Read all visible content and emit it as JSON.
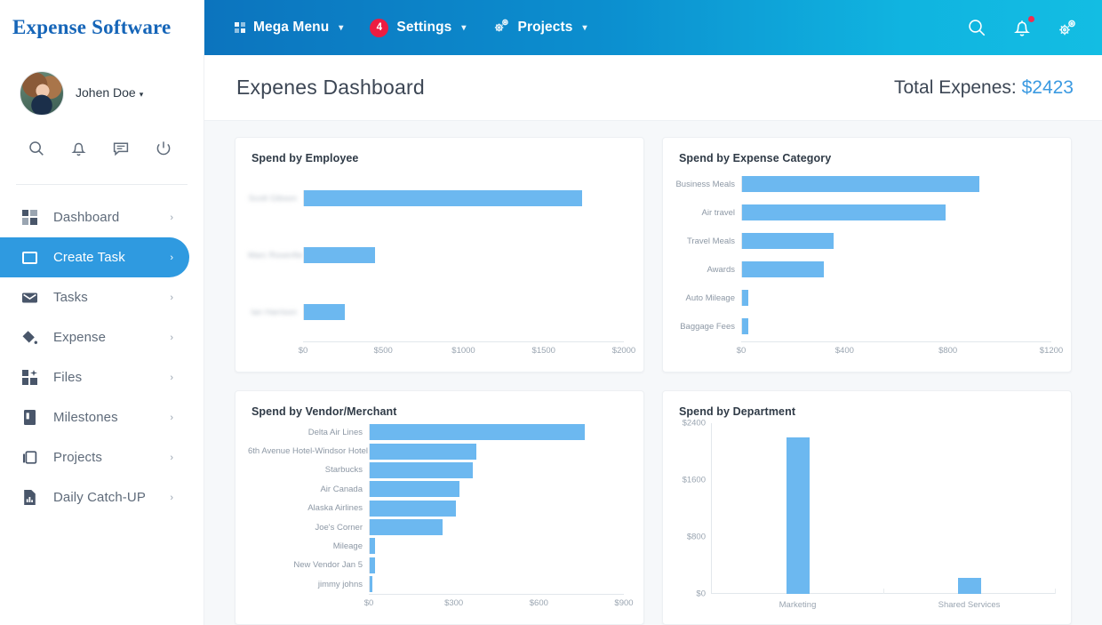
{
  "brand": {
    "title": "Expense Software"
  },
  "navbar": {
    "items": [
      {
        "label": "Mega Menu",
        "icon": "grid-icon",
        "caret": "▾",
        "badge": null
      },
      {
        "label": "Settings",
        "icon": "badge-count",
        "caret": "▾",
        "badge": "4"
      },
      {
        "label": "Projects",
        "icon": "gears-icon",
        "caret": "▾",
        "badge": null
      }
    ],
    "right_icons": [
      {
        "name": "search-icon",
        "alert": false
      },
      {
        "name": "bell-icon",
        "alert": true
      },
      {
        "name": "gears-icon",
        "alert": false
      }
    ],
    "badge_color": "#ec1c41",
    "gradient_from": "#0c74be",
    "gradient_to": "#13bde3"
  },
  "sidebar": {
    "profile": {
      "name": "Johen Doe",
      "caret": "▾",
      "avatar": "user-avatar"
    },
    "quick_icons": [
      {
        "name": "search-icon"
      },
      {
        "name": "bell-icon"
      },
      {
        "name": "chat-icon"
      },
      {
        "name": "power-icon"
      }
    ],
    "chevron": "›",
    "items": [
      {
        "label": "Dashboard",
        "icon": "dashboard-grid-icon",
        "active": false
      },
      {
        "label": "Create Task",
        "icon": "square-icon",
        "active": true
      },
      {
        "label": "Tasks",
        "icon": "envelope-icon",
        "active": false
      },
      {
        "label": "Expense",
        "icon": "paint-bucket-icon",
        "active": false
      },
      {
        "label": "Files",
        "icon": "files-icon",
        "active": false
      },
      {
        "label": "Milestones",
        "icon": "book-icon",
        "active": false
      },
      {
        "label": "Projects",
        "icon": "copy-layers-icon",
        "active": false
      },
      {
        "label": "Daily Catch-UP",
        "icon": "report-chart-icon",
        "active": false
      }
    ],
    "active_color": "#2f9ae0"
  },
  "page": {
    "title": "Expenes Dashboard",
    "total_label": "Total Expenes: ",
    "total_value": "$2423",
    "total_value_color": "#3b9ae1"
  },
  "chart_data": [
    {
      "type": "bar",
      "orientation": "horizontal",
      "title": "Spend by Employee",
      "categories": [
        "Scott Gibson",
        "Marc Rosenfield",
        "Ian Harrison"
      ],
      "labels_redacted": true,
      "values": [
        1720,
        440,
        255
      ],
      "xlabel": "",
      "ylabel": "",
      "xlim": [
        0,
        2000
      ],
      "xticks": [
        0,
        500,
        1000,
        1500,
        2000
      ],
      "xticklabels": [
        "$0",
        "$500",
        "$1000",
        "$1500",
        "$2000"
      ],
      "grid": false,
      "bar_color": "#6cb8f0"
    },
    {
      "type": "bar",
      "orientation": "horizontal",
      "title": "Spend by Expense Category",
      "categories": [
        "Business Meals",
        "Air travel",
        "Travel Meals",
        "Awards",
        "Auto Mileage",
        "Baggage Fees"
      ],
      "labels_redacted": false,
      "values": [
        910,
        780,
        352,
        312,
        25,
        25
      ],
      "xlabel": "",
      "ylabel": "",
      "xlim": [
        0,
        1200
      ],
      "xticks": [
        0,
        400,
        800,
        1200
      ],
      "xticklabels": [
        "$0",
        "$400",
        "$800",
        "$1200"
      ],
      "grid": false,
      "bar_color": "#6cb8f0"
    },
    {
      "type": "bar",
      "orientation": "horizontal",
      "title": "Spend by Vendor/Merchant",
      "categories": [
        "Delta Air Lines",
        "6th Avenue Hotel-Windsor Hotel",
        "Starbucks",
        "Air Canada",
        "Alaska Airlines",
        "Joe's Corner",
        "Mileage",
        "New Vendor Jan 5",
        "jimmy johns"
      ],
      "labels_redacted": false,
      "values": [
        750,
        372,
        360,
        312,
        300,
        255,
        20,
        18,
        10
      ],
      "xlabel": "",
      "ylabel": "",
      "xlim": [
        0,
        900
      ],
      "xticks": [
        0,
        300,
        600,
        900
      ],
      "xticklabels": [
        "$0",
        "$300",
        "$600",
        "$900"
      ],
      "grid": false,
      "bar_color": "#6cb8f0"
    },
    {
      "type": "bar",
      "orientation": "vertical",
      "title": "Spend by Department",
      "categories": [
        "Marketing",
        "Shared Services"
      ],
      "labels_redacted": false,
      "values": [
        2200,
        225
      ],
      "xlabel": "",
      "ylabel": "",
      "ylim": [
        0,
        2400
      ],
      "yticks": [
        0,
        800,
        1600,
        2400
      ],
      "yticklabels": [
        "$0",
        "$800",
        "$1600",
        "$2400"
      ],
      "grid": false,
      "bar_color": "#6cb8f0"
    }
  ]
}
